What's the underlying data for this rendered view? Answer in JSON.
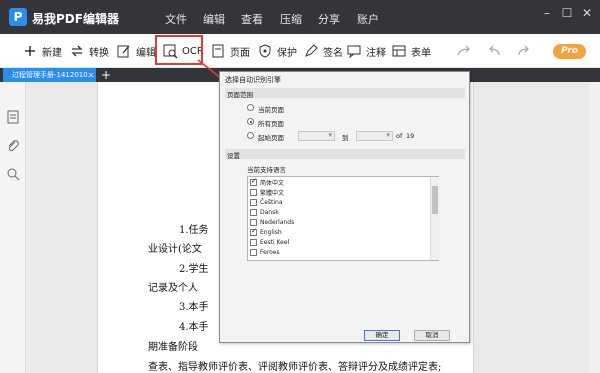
{
  "app": {
    "title": "易我PDF编辑器",
    "logo_letter": "P"
  },
  "menu": [
    "文件",
    "编辑",
    "查看",
    "压缩",
    "分享",
    "账户"
  ],
  "window_controls": [
    "–",
    "☐",
    "✕"
  ],
  "toolbar": {
    "new": "新建",
    "convert": "转换",
    "edit": "编辑",
    "ocr": "OCR",
    "page": "页面",
    "protect": "保护",
    "sign": "签名",
    "comment": "注释",
    "form": "表单",
    "pro": "Pro"
  },
  "tab": {
    "label": "过程管理手册-1412010...",
    "close": "×",
    "add": "+"
  },
  "document": {
    "lines": [
      "1.任务",
      "业设计(论文",
      "2.学生",
      "记录及个人",
      "3.本手",
      "4.本手",
      "期准备阶段",
      "查表、指导教师评价表、评阅教师评价表、答辩评分及成绩评定表;"
    ]
  },
  "dialog": {
    "title": "选择自动识别引擎",
    "page_range_label": "页面范围",
    "current_page": "当前页面",
    "all_pages": "所有页面",
    "start_page": "起始页面",
    "to": "到",
    "of": "of",
    "total_pages": "19",
    "settings_label": "设置",
    "support_lang_label": "当前支持语言",
    "languages": [
      {
        "name": "简体中文",
        "checked": true
      },
      {
        "name": "繁體中文",
        "checked": false
      },
      {
        "name": "Čeština",
        "checked": false
      },
      {
        "name": "Dansk",
        "checked": false
      },
      {
        "name": "Nederlands",
        "checked": false
      },
      {
        "name": "English",
        "checked": true
      },
      {
        "name": "Eesti Keel",
        "checked": false
      },
      {
        "name": "Feroes",
        "checked": false
      }
    ],
    "ok": "确定",
    "cancel": "取消"
  },
  "colors": {
    "titlebar": "#34353b",
    "accent": "#2a8df0",
    "highlight": "#e53935",
    "pro": "#f2a43a"
  }
}
